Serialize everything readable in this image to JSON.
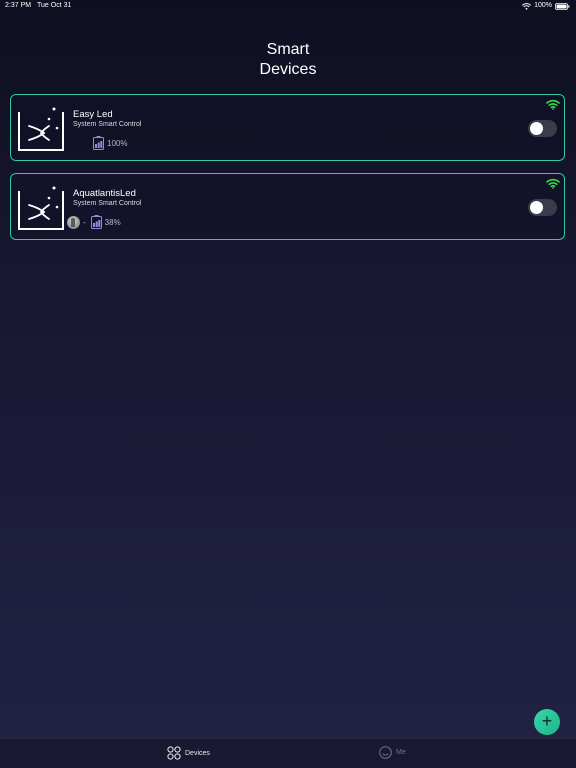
{
  "status_bar": {
    "time": "2:37 PM",
    "date": "Tue Oct 31",
    "battery": "100%"
  },
  "page": {
    "title_line1": "Smart",
    "title_line2": "Devices"
  },
  "devices": [
    {
      "name": "Easy Led",
      "subtitle": "System Smart Control",
      "battery": "100%",
      "wifi_color": "#33dd44",
      "toggle_on": false
    },
    {
      "name": "AquatlantisLed",
      "subtitle": "System Smart Control",
      "avatar_dash": "-",
      "battery": "38%",
      "wifi_color": "#33dd44",
      "toggle_on": false
    }
  ],
  "fab": {
    "label": "+"
  },
  "tabs": [
    {
      "label": "Devices",
      "icon": "grid-icon",
      "active": true
    },
    {
      "label": "Me",
      "icon": "face-icon",
      "active": false
    }
  ],
  "colors": {
    "accent": "#2fc9a2",
    "wifi": "#33dd44"
  }
}
